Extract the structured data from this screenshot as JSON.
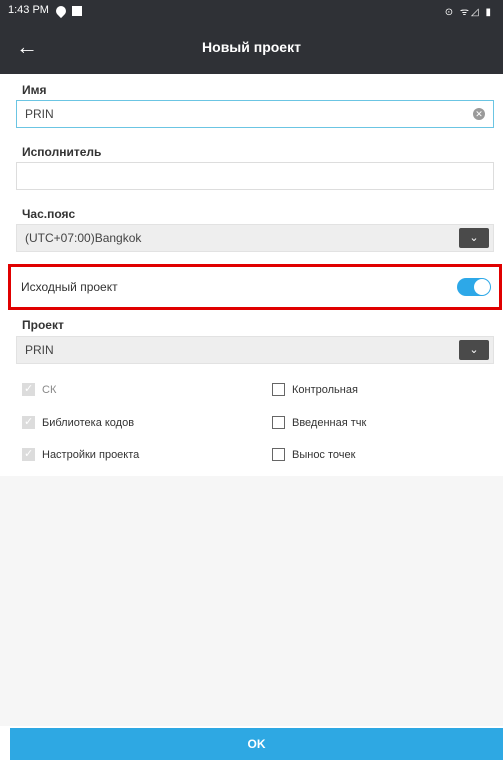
{
  "status": {
    "time": "1:43 PM",
    "right_icons": "⊙ ᯤ◿ ▮"
  },
  "appbar": {
    "back_icon": "←",
    "title": "Новый проект"
  },
  "form": {
    "name_label": "Имя",
    "name_value": "PRIN",
    "executor_label": "Исполнитель",
    "executor_value": "",
    "tz_label": "Час.пояс",
    "tz_value": "(UTC+07:00)Bangkok",
    "source_label": "Исходный проект",
    "source_on": true,
    "project_label": "Проект",
    "project_value": "PRIN"
  },
  "checks_left": [
    {
      "label": "СК",
      "checked": true
    },
    {
      "label": "Библиотека кодов",
      "checked": true
    },
    {
      "label": "Настройки проекта",
      "checked": true
    }
  ],
  "checks_right": [
    {
      "label": "Контрольная",
      "checked": false
    },
    {
      "label": "Введенная тчк",
      "checked": false
    },
    {
      "label": "Вынос точек",
      "checked": false
    }
  ],
  "ok_label": "OK",
  "colors": {
    "accent": "#2ea8e3",
    "bar": "#2f3136",
    "highlight": "#e00000"
  }
}
